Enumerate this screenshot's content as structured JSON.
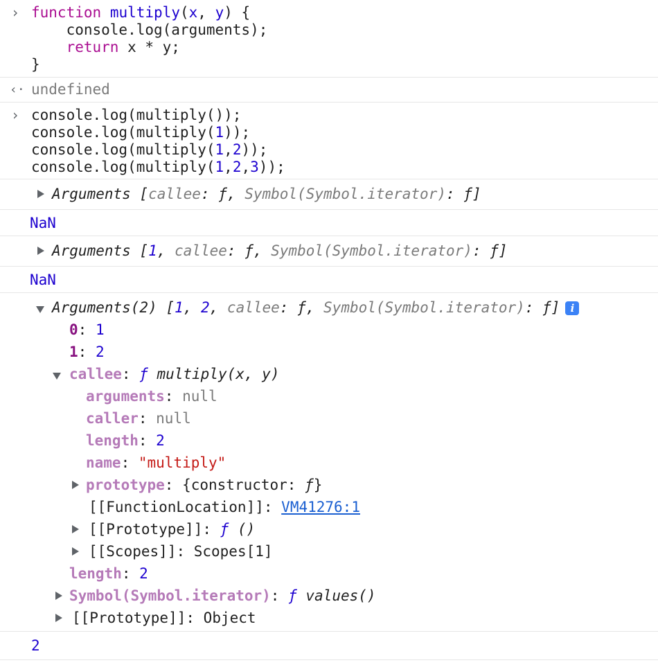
{
  "colors": {
    "keyword": "#aa0d91",
    "number": "#1c00cf",
    "property_key": "#b57ab8",
    "index_key": "#881280",
    "string": "#c41a16",
    "link": "#1a5fd1",
    "info_badge": "#3b82f6",
    "divider": "#e6e6e6"
  },
  "icons": {
    "prompt": "chevron-right-icon",
    "result": "result-arrow-icon",
    "collapsed": "triangle-right-icon",
    "expanded": "triangle-down-icon",
    "info": "info-icon"
  },
  "entry1": {
    "l1_kw": "function",
    "l1_fn": "multiply",
    "l1_a": "(",
    "l1_x": "x",
    "l1_b": ", ",
    "l1_y": "y",
    "l1_c": ") {",
    "l2": "    console.log(arguments);",
    "l3_indent": "    ",
    "l3_kw": "return",
    "l3_rest": " x * y;",
    "l4": "}"
  },
  "result1": "undefined",
  "entry2": {
    "l1": "console.log(multiply());",
    "l2_a": "console.log(multiply(",
    "l2_n1": "1",
    "l2_b": "));",
    "l3_a": "console.log(multiply(",
    "l3_n1": "1",
    "l3_c1": ",",
    "l3_n2": "2",
    "l3_b": "));",
    "l4_a": "console.log(multiply(",
    "l4_n1": "1",
    "l4_c1": ",",
    "l4_n2": "2",
    "l4_c2": ",",
    "l4_n3": "3",
    "l4_b": "));"
  },
  "log1": {
    "a": "Arguments [",
    "callee": "callee",
    "b": ": ",
    "f": "ƒ",
    "c": ", ",
    "sym": "Symbol(Symbol.iterator)",
    "d": ": ",
    "f2": "ƒ",
    "e": "]"
  },
  "nan1": "NaN",
  "log2": {
    "a": "Arguments [",
    "n1": "1",
    "b": ", ",
    "callee": "callee",
    "c": ": ",
    "f": "ƒ",
    "d": ", ",
    "sym": "Symbol(Symbol.iterator)",
    "e": ": ",
    "f2": "ƒ",
    "g": "]"
  },
  "nan2": "NaN",
  "log3": {
    "summary_a": "Arguments(2) [",
    "summary_n1": "1",
    "summary_b": ", ",
    "summary_n2": "2",
    "summary_c": ", ",
    "summary_callee": "callee",
    "summary_d": ": ",
    "summary_f": "ƒ",
    "summary_e": ", ",
    "summary_sym": "Symbol(Symbol.iterator)",
    "summary_g": ": ",
    "summary_f2": "ƒ",
    "summary_h": "]",
    "info_badge": "i",
    "idx0_key": "0",
    "idx0_val": "1",
    "idx1_key": "1",
    "idx1_val": "2",
    "callee_key": "callee",
    "callee_f": "ƒ",
    "callee_sig": " multiply(x, y)",
    "arguments_key": "arguments",
    "arguments_val": "null",
    "caller_key": "caller",
    "caller_val": "null",
    "length_key": "length",
    "length_val": "2",
    "name_key": "name",
    "name_val": "\"multiply\"",
    "prototype_key": "prototype",
    "prototype_a": "{constructor: ",
    "prototype_f": "ƒ",
    "prototype_b": "}",
    "funcloc_key": "[[FunctionLocation]]",
    "funcloc_val": "VM41276:1",
    "proto_key": "[[Prototype]]",
    "proto_f": "ƒ",
    "proto_sig": " ()",
    "scopes_key": "[[Scopes]]",
    "scopes_val": "Scopes[1]",
    "args_length_key": "length",
    "args_length_val": "2",
    "iter_key": "Symbol(Symbol.iterator)",
    "iter_f": "ƒ",
    "iter_sig": " values()",
    "args_proto_key": "[[Prototype]]",
    "args_proto_val": "Object"
  },
  "final_value": "2"
}
